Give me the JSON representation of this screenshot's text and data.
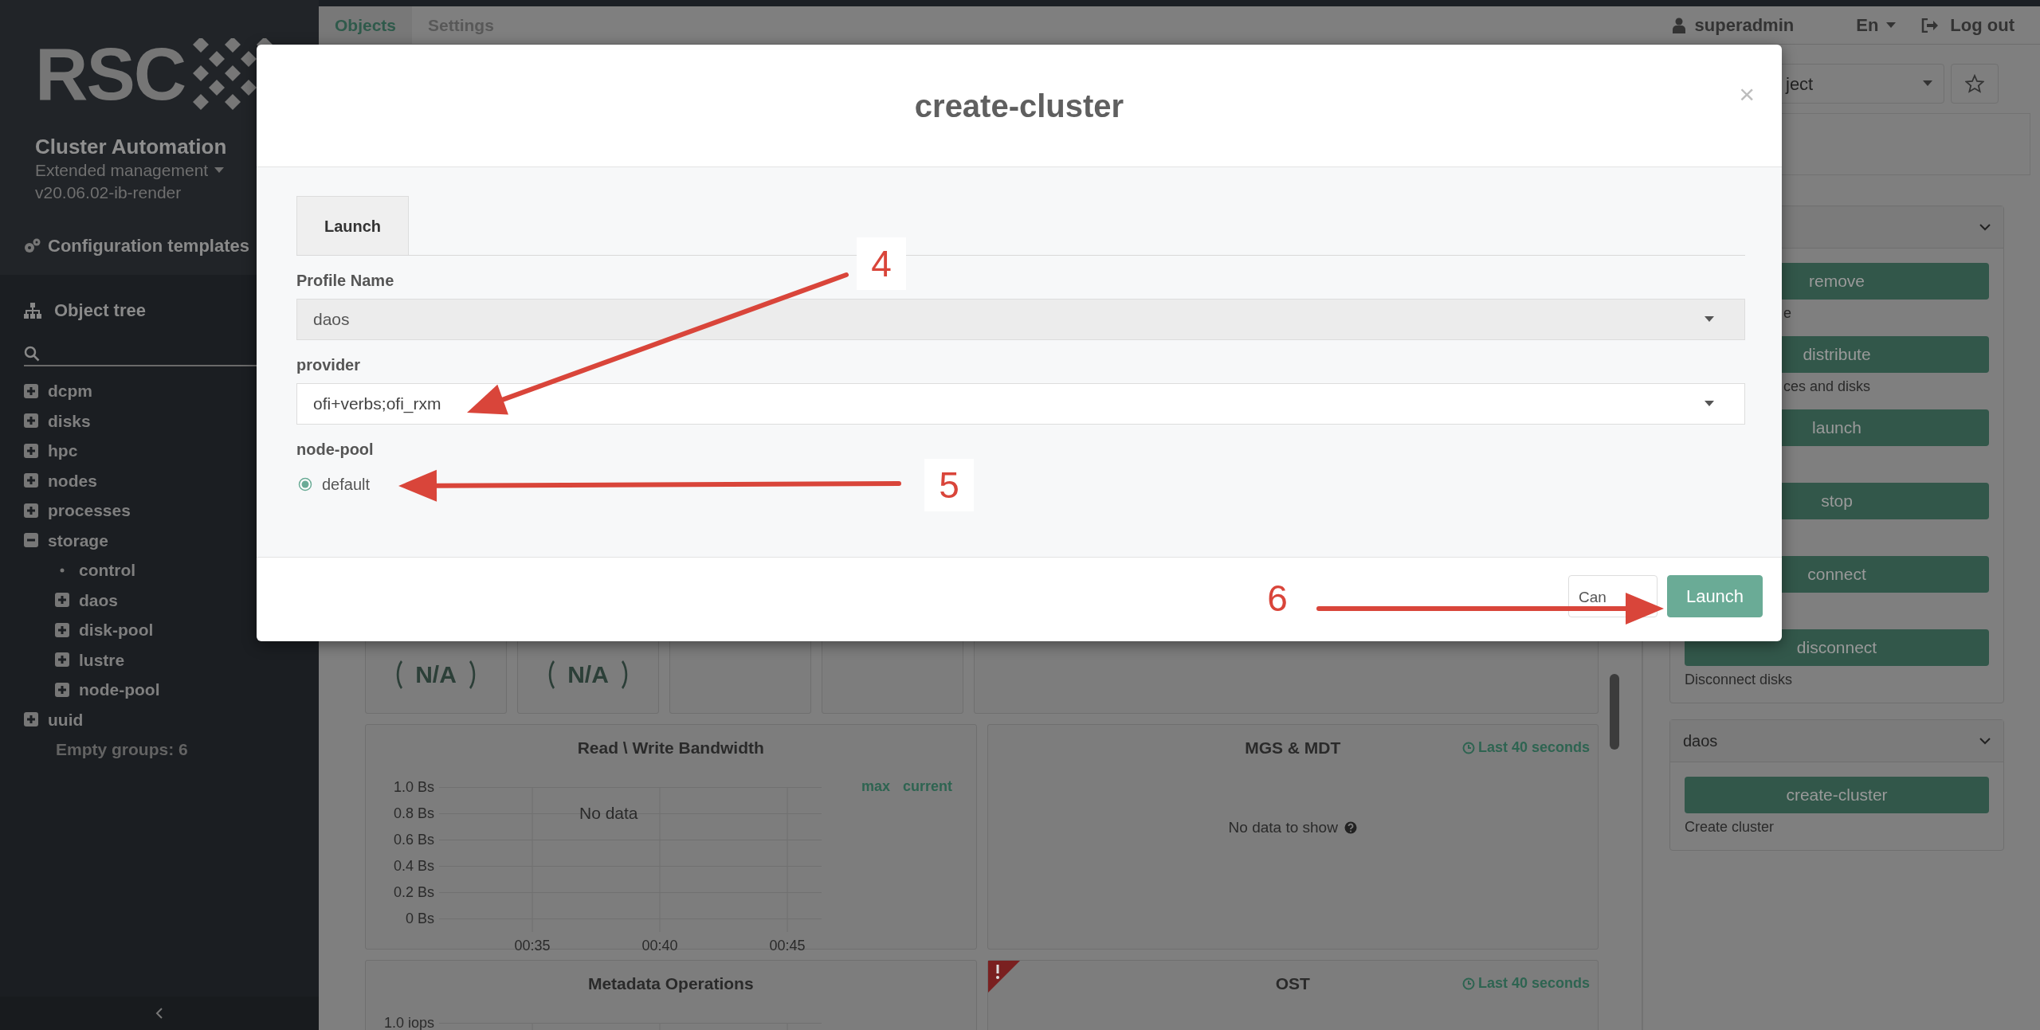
{
  "sidebar": {
    "logo_text": "RSC",
    "app_title": "Cluster Automation",
    "edition": "Extended management",
    "version": "v20.06.02-ib-render",
    "config_link": "Configuration templates",
    "tree_heading": "Object tree",
    "tree": [
      {
        "label": "dcpm",
        "kind": "group",
        "expanded": false
      },
      {
        "label": "disks",
        "kind": "group",
        "expanded": false
      },
      {
        "label": "hpc",
        "kind": "group",
        "expanded": false
      },
      {
        "label": "nodes",
        "kind": "group",
        "expanded": false
      },
      {
        "label": "processes",
        "kind": "group",
        "expanded": false
      },
      {
        "label": "storage",
        "kind": "group",
        "expanded": true,
        "children": [
          {
            "label": "control",
            "kind": "leaf"
          },
          {
            "label": "daos",
            "kind": "group",
            "expanded": false
          },
          {
            "label": "disk-pool",
            "kind": "group",
            "expanded": false
          },
          {
            "label": "lustre",
            "kind": "group",
            "expanded": false
          },
          {
            "label": "node-pool",
            "kind": "group",
            "expanded": false
          }
        ]
      },
      {
        "label": "uuid",
        "kind": "group",
        "expanded": false
      }
    ],
    "empty_groups": "Empty groups: 6"
  },
  "top_nav": {
    "tabs": [
      {
        "label": "Objects",
        "selected": true
      },
      {
        "label": "Settings",
        "selected": false
      }
    ],
    "user": "superadmin",
    "language": "En",
    "logout": "Log out"
  },
  "object_select": {
    "value": "ject"
  },
  "action_panels": [
    {
      "actions": [
        {
          "label": "remove",
          "description": "e"
        },
        {
          "label": "distribute",
          "description": "ces and disks"
        },
        {
          "label": "launch"
        },
        {
          "label": "stop"
        },
        {
          "label": "connect"
        },
        {
          "label": "disconnect",
          "description": "Disconnect disks"
        }
      ]
    },
    {
      "title": "daos",
      "actions": [
        {
          "label": "create-cluster",
          "description": "Create cluster"
        }
      ]
    }
  ],
  "gauges": [
    {
      "reading": "N/A"
    },
    {
      "reading": "N/A"
    }
  ],
  "charts": [
    {
      "title": "Read \\ Write Bandwidth",
      "message": "No data",
      "y_ticks": [
        "1.0 Bs",
        "0.8 Bs",
        "0.6 Bs",
        "0.4 Bs",
        "0.2 Bs",
        "0 Bs"
      ],
      "x_ticks": [
        "00:35",
        "00:40",
        "00:45"
      ],
      "legend": [
        "max",
        "current"
      ]
    },
    {
      "title": "MGS & MDT",
      "period": "Last 40 seconds",
      "message": "No data to show",
      "warning": false
    },
    {
      "title": "Metadata Operations",
      "y_ticks": [
        "1.0 iops"
      ]
    },
    {
      "title": "OST",
      "period": "Last 40 seconds",
      "warning": true
    }
  ],
  "modal": {
    "title": "create-cluster",
    "close": "×",
    "tabs": [
      {
        "label": "Launch",
        "selected": true
      }
    ],
    "fields": [
      {
        "label": "Profile Name",
        "kind": "select",
        "value": "daos",
        "disabled": true
      },
      {
        "label": "provider",
        "kind": "select",
        "value": "ofi+verbs;ofi_rxm",
        "disabled": false
      },
      {
        "label": "node-pool",
        "kind": "radio",
        "options": [
          {
            "label": "default",
            "selected": true
          }
        ]
      }
    ],
    "buttons": [
      {
        "label": "Can",
        "kind": "secondary"
      },
      {
        "label": "Launch",
        "kind": "primary"
      }
    ]
  },
  "annotations": [
    {
      "label": "4"
    },
    {
      "label": "5"
    },
    {
      "label": "6"
    }
  ]
}
